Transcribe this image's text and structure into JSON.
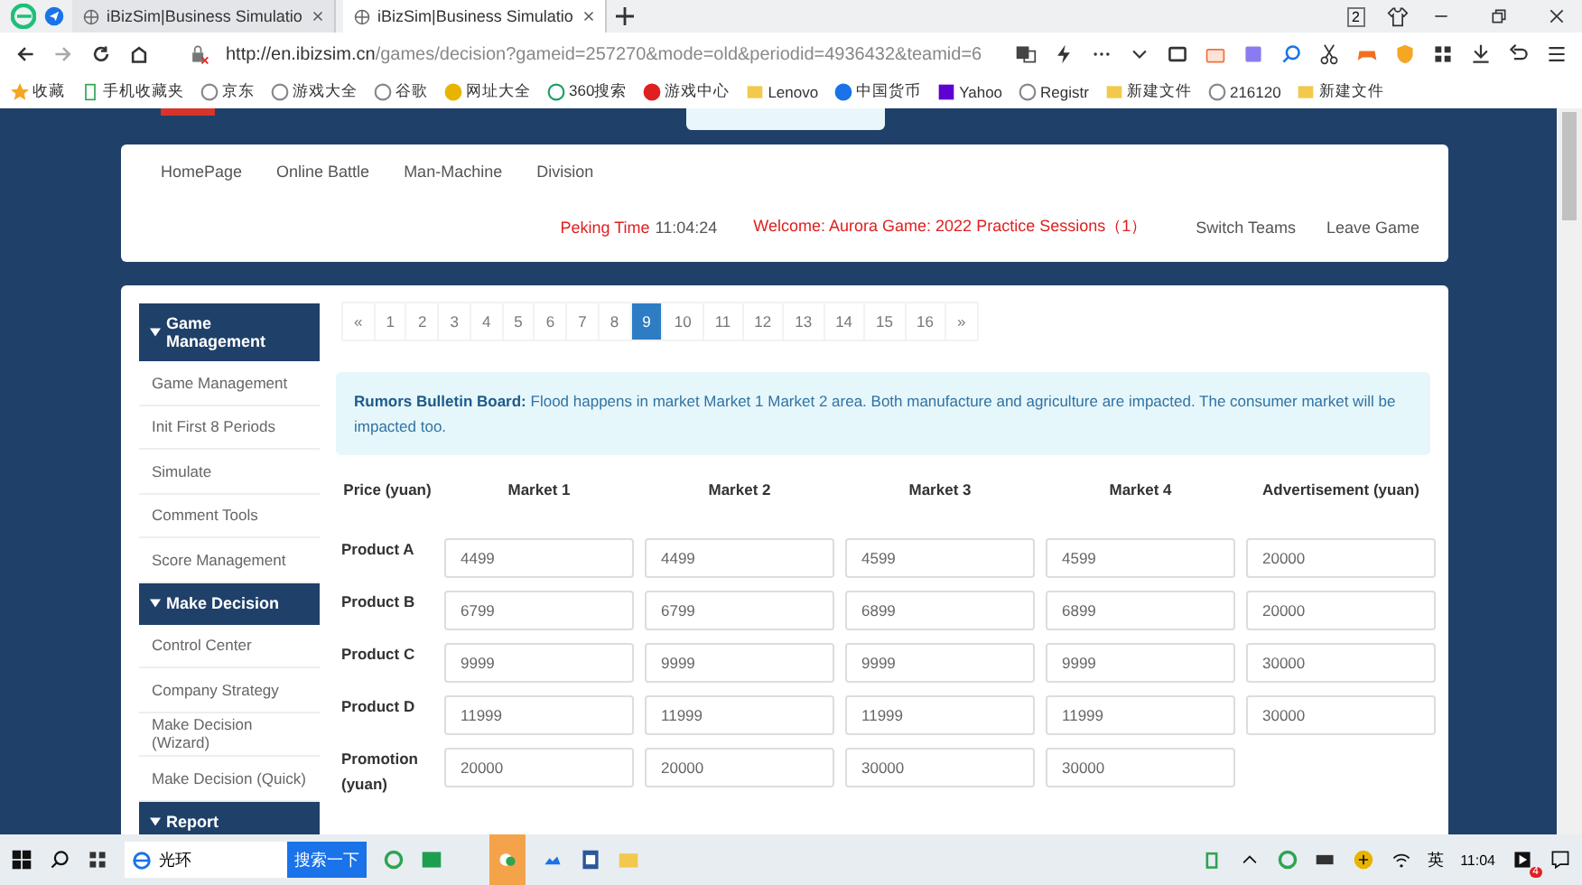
{
  "browser": {
    "tabs": [
      {
        "title": "iBizSim|Business Simulatio",
        "selected": false
      },
      {
        "title": "iBizSim|Business Simulatio",
        "selected": true
      }
    ],
    "window_count": "2",
    "url": {
      "host": "http://en.ibizsim.cn",
      "path": "/games/decision?gameid=257270&mode=old&periodid=4936432&teamid=6"
    },
    "bookmarks": [
      {
        "label": "收藏",
        "kind": "star"
      },
      {
        "label": "手机收藏夹",
        "kind": "phone"
      },
      {
        "label": "京东",
        "kind": "globe"
      },
      {
        "label": "游戏大全",
        "kind": "globe"
      },
      {
        "label": "谷歌",
        "kind": "globe"
      },
      {
        "label": "网址大全",
        "kind": "plus"
      },
      {
        "label": "360搜索",
        "kind": "ring"
      },
      {
        "label": "游戏中心",
        "kind": "game"
      },
      {
        "label": "Lenovo",
        "kind": "folder"
      },
      {
        "label": "中国货币",
        "kind": "blue"
      },
      {
        "label": "Yahoo",
        "kind": "yahoo"
      },
      {
        "label": "Registr",
        "kind": "globe"
      },
      {
        "label": "新建文件",
        "kind": "folder"
      },
      {
        "label": "216120",
        "kind": "globe"
      },
      {
        "label": "新建文件",
        "kind": "folder"
      }
    ]
  },
  "nav": {
    "links": [
      "HomePage",
      "Online Battle",
      "Man-Machine",
      "Division"
    ],
    "time_label": "Peking Time",
    "time": "11:04:24",
    "welcome": "Welcome: Aurora Game: 2022 Practice Sessions（1）",
    "actions": [
      "Switch Teams",
      "Leave Game"
    ]
  },
  "sidebar": [
    {
      "title": "Game Management",
      "expanded": true,
      "items": [
        "Game Management",
        "Init First 8 Periods",
        "Simulate",
        "Comment Tools",
        "Score Management"
      ]
    },
    {
      "title": "Make Decision",
      "expanded": true,
      "items": [
        "Control Center",
        "Company Strategy",
        "Make Decision (Wizard)",
        "Make Decision (Quick)"
      ]
    },
    {
      "title": "Report",
      "expanded": true
    }
  ],
  "pagination": {
    "prev": "«",
    "next": "»",
    "pages": [
      {
        "label": "1",
        "selected": false
      },
      {
        "label": "2",
        "selected": false
      },
      {
        "label": "3",
        "selected": false
      },
      {
        "label": "4",
        "selected": false
      },
      {
        "label": "5",
        "selected": false
      },
      {
        "label": "6",
        "selected": false
      },
      {
        "label": "7",
        "selected": false
      },
      {
        "label": "8",
        "selected": false
      },
      {
        "label": "9",
        "selected": true
      },
      {
        "label": "10",
        "selected": false
      },
      {
        "label": "11",
        "selected": false
      },
      {
        "label": "12",
        "selected": false
      },
      {
        "label": "13",
        "selected": false
      },
      {
        "label": "14",
        "selected": false
      },
      {
        "label": "15",
        "selected": false
      },
      {
        "label": "16",
        "selected": false
      }
    ]
  },
  "bulletin": {
    "title": "Rumors Bulletin Board:",
    "text": "Flood happens in market Market 1 Market 2 area. Both manufacture and agriculture are impacted. The consumer market will be impacted too."
  },
  "table": {
    "corner": "Price (yuan)",
    "columns": [
      "Market 1",
      "Market 2",
      "Market 3",
      "Market 4",
      "Advertisement (yuan)"
    ],
    "rows": [
      {
        "label": "Product A",
        "values": [
          "4499",
          "4499",
          "4599",
          "4599",
          "20000"
        ]
      },
      {
        "label": "Product B",
        "values": [
          "6799",
          "6799",
          "6899",
          "6899",
          "20000"
        ]
      },
      {
        "label": "Product C",
        "values": [
          "9999",
          "9999",
          "9999",
          "9999",
          "30000"
        ]
      },
      {
        "label": "Product D",
        "values": [
          "11999",
          "11999",
          "11999",
          "11999",
          "30000"
        ]
      },
      {
        "label": "Promotion (yuan)",
        "values": [
          "20000",
          "20000",
          "30000",
          "30000"
        ]
      }
    ]
  },
  "taskbar": {
    "search": "光环",
    "search_button": "搜索一下",
    "ime": "英",
    "clock": "11:04",
    "notification_count": "4"
  }
}
